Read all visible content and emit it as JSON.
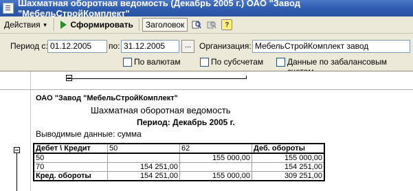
{
  "window": {
    "title": "Шахматная оборотная ведомость (Декабрь 2005 г.) ОАО \"Завод \"МебельСтройКомплект\""
  },
  "toolbar": {
    "actions_label": "Действия",
    "generate_label": "Сформировать",
    "header_label": "Заголовок",
    "help_label": "?"
  },
  "form": {
    "period_from_label": "Период с:",
    "period_from_value": "01.12.2005",
    "period_to_label": "по:",
    "period_to_value": "31.12.2005",
    "dots_label": "...",
    "org_label": "Организация:",
    "org_value": "МебельСтройКомплект завод",
    "check_currency": "По валютам",
    "check_subaccounts": "По субсчетам",
    "check_offbalance": "Данные по забалансовым счетам"
  },
  "report": {
    "company": "ОАО \"Завод \"МебельСтройКомплект\"",
    "title": "Шахматная оборотная ведомость",
    "period": "Период: Декабрь 2005 г.",
    "shown_data": "Выводимые данные: сумма",
    "table": {
      "headers": [
        "Дебет \\ Кредит",
        "50",
        "62",
        "Деб. обороты"
      ],
      "rows": [
        [
          "50",
          "",
          "155 000,00",
          "155 000,00"
        ],
        [
          "70",
          "154 251,00",
          "",
          "154 251,00"
        ],
        [
          "Кред. обороты",
          "154 251,00",
          "155 000,00",
          "309 251,00"
        ]
      ]
    }
  }
}
